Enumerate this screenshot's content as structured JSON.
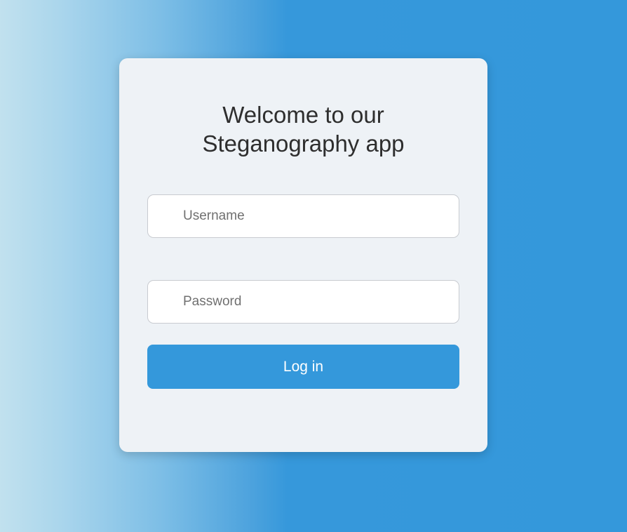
{
  "login": {
    "title_line1": "Welcome to our",
    "title_line2": "Steganography app",
    "username": {
      "placeholder": "Username",
      "value": ""
    },
    "password": {
      "placeholder": "Password",
      "value": ""
    },
    "submit_label": "Log in"
  },
  "colors": {
    "background_accent": "#3498db",
    "card_background": "#eef2f6",
    "button_background": "#3498db",
    "button_text": "#ffffff",
    "title_text": "#2e2e2e"
  }
}
